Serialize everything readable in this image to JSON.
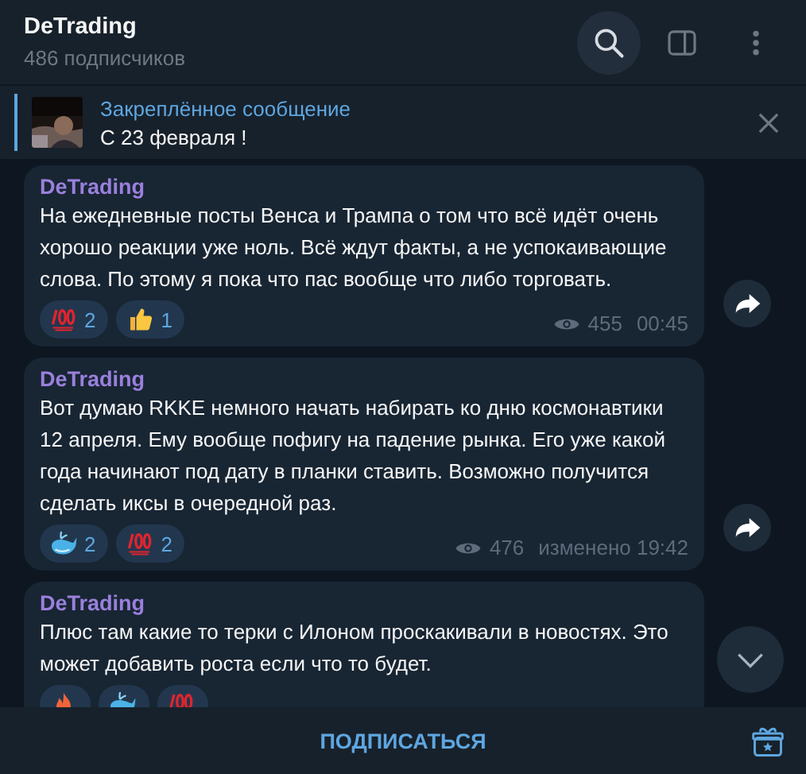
{
  "header": {
    "title": "DeTrading",
    "subtitle": "486 подписчиков"
  },
  "pinned": {
    "label": "Закреплённое сообщение",
    "text": "С 23 февраля !"
  },
  "messages": [
    {
      "author": "DeTrading",
      "text": "На ежедневные посты Венса и Трампа о том что всё идёт очень хорошо реакции уже ноль. Всё ждут факты, а не успокаивающие слова. По этому я пока что пас вообще что либо торговать.",
      "reactions": [
        {
          "kind": "hundred",
          "count": "2"
        },
        {
          "kind": "thumbs",
          "count": "1"
        }
      ],
      "views": "455",
      "time": "00:45"
    },
    {
      "author": "DeTrading",
      "text": "Вот думаю RKKE немного начать набирать ко дню космонавтики 12 апреля. Ему вообще пофигу на падение рынка. Его уже какой года начинают под дату в планки ставить. Возможно получится сделать иксы в очередной раз.",
      "reactions": [
        {
          "kind": "whale",
          "count": "2"
        },
        {
          "kind": "hundred",
          "count": "2"
        }
      ],
      "views": "476",
      "time": "изменено 19:42"
    },
    {
      "author": "DeTrading",
      "text": "Плюс там какие то терки с Илоном проскакивали в новостях. Это может добавить роста если что то будет.",
      "reactions": [
        {
          "kind": "fire"
        },
        {
          "kind": "whale"
        },
        {
          "kind": "hundred"
        }
      ]
    }
  ],
  "footer": {
    "action": "ПОДПИСАТЬСЯ"
  }
}
